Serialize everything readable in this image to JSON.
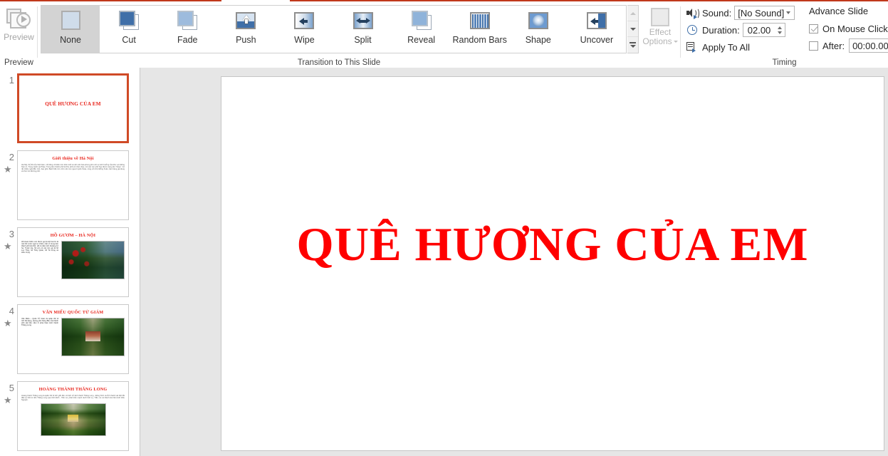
{
  "ribbon": {
    "preview_group": {
      "label": "Preview",
      "button_label": "Preview",
      "icon": "preview-play-icon",
      "enabled": false
    },
    "transition_group": {
      "label": "Transition to This Slide",
      "selected": "None",
      "items": [
        {
          "label": "None",
          "icon": "transition-none-icon"
        },
        {
          "label": "Cut",
          "icon": "transition-cut-icon"
        },
        {
          "label": "Fade",
          "icon": "transition-fade-icon"
        },
        {
          "label": "Push",
          "icon": "transition-push-icon"
        },
        {
          "label": "Wipe",
          "icon": "transition-wipe-icon"
        },
        {
          "label": "Split",
          "icon": "transition-split-icon"
        },
        {
          "label": "Reveal",
          "icon": "transition-reveal-icon"
        },
        {
          "label": "Random Bars",
          "icon": "transition-random-bars-icon"
        },
        {
          "label": "Shape",
          "icon": "transition-shape-icon"
        },
        {
          "label": "Uncover",
          "icon": "transition-uncover-icon"
        }
      ],
      "scroll_up_icon": "scroll-up-icon",
      "scroll_down_icon": "scroll-down-icon",
      "more_icon": "gallery-more-icon"
    },
    "effect_options": {
      "label_line1": "Effect",
      "label_line2": "Options",
      "icon": "effect-options-icon",
      "enabled": false
    },
    "timing_group": {
      "label": "Timing",
      "sound_label": "Sound:",
      "sound_value": "[No Sound]",
      "sound_icon": "speaker-icon",
      "duration_label": "Duration:",
      "duration_value": "02.00",
      "duration_icon": "clock-icon",
      "apply_to_all_label": "Apply To All",
      "apply_to_all_icon": "apply-to-all-icon",
      "advance_slide_label": "Advance Slide",
      "on_mouse_click_label": "On Mouse Click",
      "on_mouse_click_checked": true,
      "after_label": "After:",
      "after_checked": false,
      "after_value": "00:00.00"
    }
  },
  "thumbnails": {
    "slides": [
      {
        "number": "1",
        "title": "QUÊ HƯƠNG CỦA EM",
        "active": true,
        "has_animation_star": false,
        "layout": "title-only"
      },
      {
        "number": "2",
        "title": "Giới thiệu về Hà Nội",
        "active": false,
        "has_animation_star": true,
        "layout": "text",
        "body": "Hà Nội, thủ đô của Việt Nam, nổi tiếng với kiến trúc trăm tuổi và nền văn hóa phong phú với sự ảnh hưởng của khu vực Đông Nam Á, Trung Quốc và Pháp. Trung tâm thành phố là Khu phố cổ nhộn nhịp, nơi các con phố hẹp được mang tên \"hàng\". Có rất nhiều ngôi đền nhỏ, bao gồm Bạch Mã, tôn vinh một con ngựa huyền thoại, cùng với chợ Đồng Xuân, bán hàng gia dụng và thức ăn đường phố."
      },
      {
        "number": "3",
        "title": "HỒ GƯƠM – HÀ NỘI",
        "active": false,
        "has_animation_star": true,
        "layout": "text-photo",
        "body": "Hồ Hoàn Kiếm còn được gọi là Hồ Gươm là một hồ nước ngọt tự nhiên, nằm ở trung tâm thành phố Hà Nội. Hồ có diện tích khoảng 12 ha. Trước kia, hồ còn có các tên gọi là hồ Lục Thủy, hồ Thủy Quân, hồ Tả Vọng và Hữu Vọng.",
        "photo": "photo-hoguom"
      },
      {
        "number": "4",
        "title": "VĂN MIẾU QUỐC TỬ GIÁM",
        "active": false,
        "has_animation_star": true,
        "layout": "text-photo",
        "body": "Văn Miếu – Quốc Tử Giám là quần thể di tích đa dạng, phong phú hàng đầu của thành phố Hà Nội, nằm ở phía Nam kinh thành Thăng Long.",
        "photo": "photo-vanmieu"
      },
      {
        "number": "5",
        "title": "HOÀNG THÀNH THĂNG LONG",
        "active": false,
        "has_animation_star": true,
        "layout": "text-over-photo",
        "body": "Hoàng thành Thăng Long là quần thể di tích gắn liền với lịch sử kinh thành Thăng Long - Đông Kinh và tỉnh thành Hà Nội bắt đầu từ thời kì tiền Thăng Long qua thời Đinh - Tiền Lê, phát triển mạnh dưới thời Lý, Trần, Lê và thành Hà Nội dưới triều Nguyễn.",
        "photo": "photo-hoangthanh"
      }
    ]
  },
  "slide_view": {
    "title": "QUÊ HƯƠNG CỦA EM",
    "title_color": "#FF0000",
    "background": "#FFFFFF"
  },
  "colors": {
    "ribbon_accent": "#C0391B",
    "selected_gallery_item": "#D3D3D3",
    "canvas_background": "#E6E6E6",
    "active_thumb_border": "#D04A26",
    "thumb_title_red": "#E8231A"
  }
}
